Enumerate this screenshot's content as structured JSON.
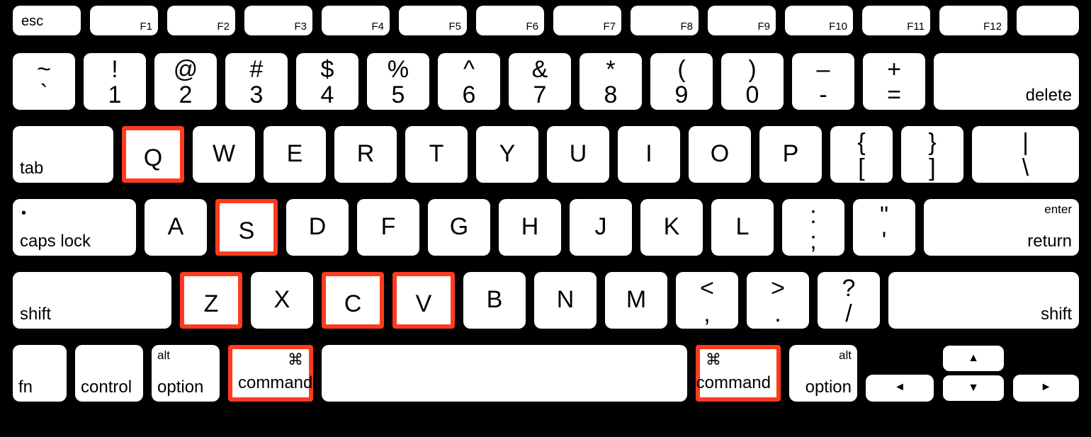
{
  "highlight_color": "#ff3b1f",
  "function_row": {
    "esc": "esc",
    "keys": [
      {
        "f": "F1",
        "icon": "brightness-down"
      },
      {
        "f": "F2",
        "icon": "brightness-up"
      },
      {
        "f": "F3",
        "icon": "mission-control"
      },
      {
        "f": "F4",
        "icon": "launchpad"
      },
      {
        "f": "F5",
        "icon": "keyboard-brightness-down"
      },
      {
        "f": "F6",
        "icon": "keyboard-brightness-up"
      },
      {
        "f": "F7",
        "icon": "rewind"
      },
      {
        "f": "F8",
        "icon": "play-pause"
      },
      {
        "f": "F9",
        "icon": "fast-forward"
      },
      {
        "f": "F10",
        "icon": "mute"
      },
      {
        "f": "F11",
        "icon": "volume-down"
      },
      {
        "f": "F12",
        "icon": "volume-up"
      }
    ],
    "power": "power"
  },
  "number_row": {
    "tilde": {
      "upper": "~",
      "lower": "`"
    },
    "keys": [
      {
        "upper": "!",
        "lower": "1"
      },
      {
        "upper": "@",
        "lower": "2"
      },
      {
        "upper": "#",
        "lower": "3"
      },
      {
        "upper": "$",
        "lower": "4"
      },
      {
        "upper": "%",
        "lower": "5"
      },
      {
        "upper": "^",
        "lower": "6"
      },
      {
        "upper": "&",
        "lower": "7"
      },
      {
        "upper": "*",
        "lower": "8"
      },
      {
        "upper": "(",
        "lower": "9"
      },
      {
        "upper": ")",
        "lower": "0"
      },
      {
        "upper": "–",
        "lower": "-"
      },
      {
        "upper": "+",
        "lower": "="
      }
    ],
    "delete": "delete"
  },
  "q_row": {
    "tab": "tab",
    "letters": [
      "Q",
      "W",
      "E",
      "R",
      "T",
      "Y",
      "U",
      "I",
      "O",
      "P"
    ],
    "bracket_l": {
      "upper": "{",
      "lower": "["
    },
    "bracket_r": {
      "upper": "}",
      "lower": "]"
    },
    "backslash": {
      "upper": "|",
      "lower": "\\"
    }
  },
  "a_row": {
    "caps": "caps lock",
    "letters": [
      "A",
      "S",
      "D",
      "F",
      "G",
      "H",
      "J",
      "K",
      "L"
    ],
    "semicolon": {
      "upper": ":",
      "lower": ";"
    },
    "quote": {
      "upper": "\"",
      "lower": "'"
    },
    "enter_top": "enter",
    "enter_bottom": "return"
  },
  "z_row": {
    "shift": "shift",
    "letters": [
      "Z",
      "X",
      "C",
      "V",
      "B",
      "N",
      "M"
    ],
    "comma": {
      "upper": "<",
      "lower": ","
    },
    "period": {
      "upper": ">",
      "lower": "."
    },
    "slash": {
      "upper": "?",
      "lower": "/"
    },
    "rshift": "shift"
  },
  "bottom_row": {
    "fn": "fn",
    "control": "control",
    "option_l_top": "alt",
    "option_l": "option",
    "command_l": "command",
    "command_r": "command",
    "option_r_top": "alt",
    "option_r": "option",
    "cmd_glyph": "⌘"
  },
  "arrows": {
    "left": "◄",
    "up": "▲",
    "down": "▼",
    "right": "►"
  },
  "highlighted_keys": [
    "Q",
    "S",
    "Z",
    "C",
    "V",
    "command_l",
    "command_r"
  ]
}
